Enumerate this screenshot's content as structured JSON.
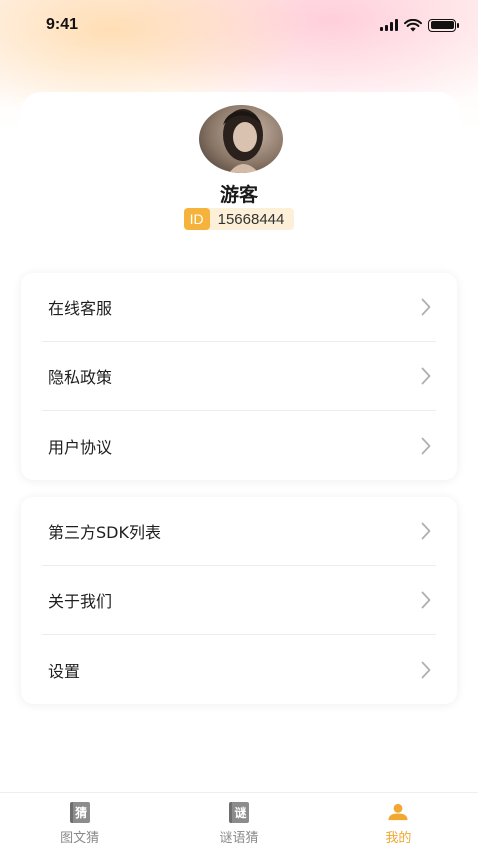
{
  "status_bar": {
    "time": "9:41"
  },
  "profile": {
    "name": "游客",
    "id_label": "ID",
    "id_value": "15668444"
  },
  "menu_group_1": [
    {
      "label": "在线客服"
    },
    {
      "label": "隐私政策"
    },
    {
      "label": "用户协议"
    }
  ],
  "menu_group_2": [
    {
      "label": "第三方SDK列表"
    },
    {
      "label": "关于我们"
    },
    {
      "label": "设置"
    }
  ],
  "tabbar": {
    "tabs": [
      {
        "label": "图文猜",
        "icon_char": "猜",
        "icon": "book-guess-icon",
        "active": false
      },
      {
        "label": "谜语猜",
        "icon_char": "谜",
        "icon": "book-riddle-icon",
        "active": false
      },
      {
        "label": "我的",
        "icon": "user-icon",
        "active": true
      }
    ]
  },
  "colors": {
    "accent": "#f0a830",
    "id_tag_bg": "#f5b33c",
    "id_pill_bg": "#fdf0d8",
    "chevron": "#b0b0b0",
    "tab_inactive": "#8a8a8a"
  }
}
